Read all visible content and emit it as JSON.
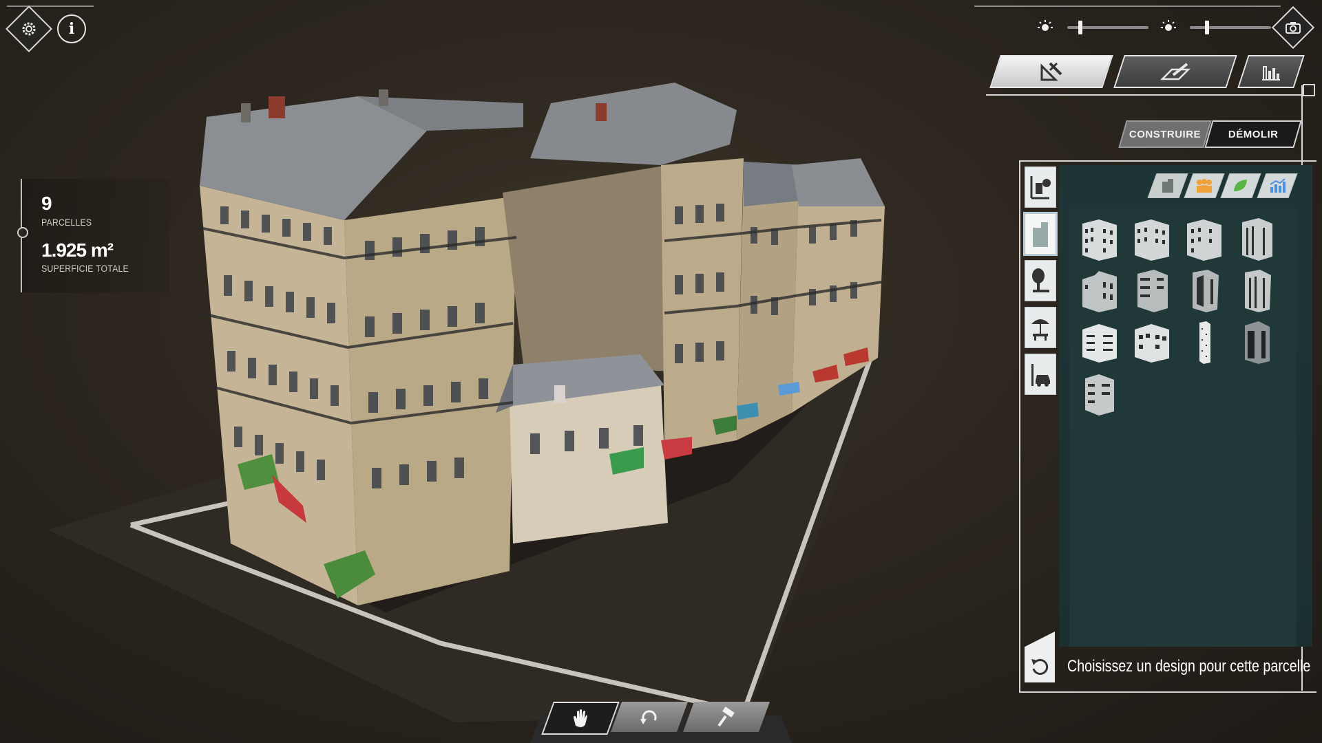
{
  "stats": {
    "parcels_value": "9",
    "parcels_label": "PARCELLES",
    "area_value": "1.925 m²",
    "area_label": "SUPERFICIE TOTALE"
  },
  "top_left": {
    "settings_icon": "gear-icon",
    "info_icon": "info-icon",
    "info_glyph": "i"
  },
  "top_right": {
    "light_slider_1": {
      "icon": "sun-icon",
      "level": 0.18
    },
    "light_slider_2": {
      "icon": "sun-icon",
      "level": 0.22
    },
    "camera_icon": "camera-icon",
    "modes": [
      {
        "name": "build-mode",
        "icon": "drafting-tools-icon",
        "active": true
      },
      {
        "name": "edit-mode",
        "icon": "pencil-ruler-icon",
        "active": false
      },
      {
        "name": "stats-mode",
        "icon": "factory-chart-icon",
        "active": false
      }
    ]
  },
  "actions": {
    "build_label": "CONSTRUIRE",
    "demolish_label": "DÉMOLIR",
    "active": "build"
  },
  "catalog": {
    "side_tabs": [
      {
        "icon": "land-parcel-icon"
      },
      {
        "icon": "buildings-icon",
        "active": true
      },
      {
        "icon": "tree-bench-icon"
      },
      {
        "icon": "kiosk-umbrella-icon"
      },
      {
        "icon": "car-parking-icon"
      }
    ],
    "filters": [
      {
        "icon": "building-filter-icon",
        "color": "#6f7777"
      },
      {
        "icon": "people-filter-icon",
        "color": "#f0a23a"
      },
      {
        "icon": "leaf-filter-icon",
        "color": "#59b544"
      },
      {
        "icon": "chart-filter-icon",
        "color": "#4b8fe0"
      }
    ],
    "designs_count": 13,
    "undo_icon": "undo-icon",
    "hint": "Choisissez un design pour cette parcelle"
  },
  "toolbar": {
    "tools": [
      {
        "icon": "hand-icon"
      },
      {
        "icon": "rotate-icon"
      },
      {
        "icon": "hammer-icon"
      }
    ]
  },
  "colors": {
    "panel_bg": "#1e3536",
    "accent_orange": "#f0a23a",
    "accent_green": "#59b544",
    "accent_blue": "#4b8fe0",
    "ui_white": "#e6e6e6"
  }
}
